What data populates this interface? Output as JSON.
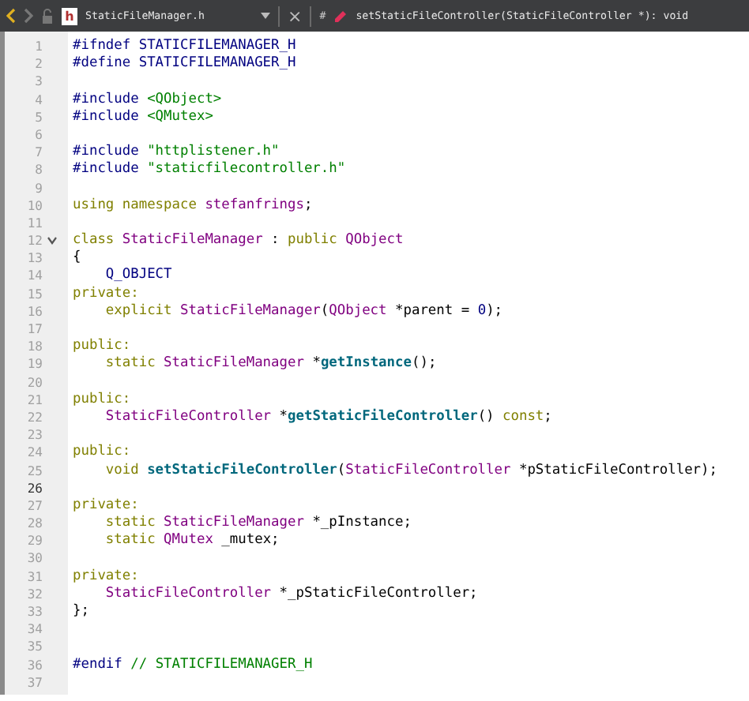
{
  "toolbar": {
    "back_enabled": true,
    "forward_enabled": false,
    "file_icon_label": "h",
    "file_name": "StaticFileManager.h",
    "close": "×",
    "hash": "#",
    "symbol": "setStaticFileController(StaticFileController *): void"
  },
  "lines": [
    {
      "number": "1",
      "selected": false,
      "foldable": false,
      "tokens": [
        {
          "kind": "pp",
          "text": "#ifndef STATICFILEMANAGER_H"
        }
      ]
    },
    {
      "number": "2",
      "selected": false,
      "foldable": false,
      "tokens": [
        {
          "kind": "pp",
          "text": "#define STATICFILEMANAGER_H"
        }
      ]
    },
    {
      "number": "3",
      "selected": false,
      "foldable": false
    },
    {
      "number": "4",
      "selected": false,
      "foldable": false,
      "tokens": [
        {
          "kind": "pp",
          "text": "#include "
        },
        {
          "kind": "str",
          "text": "<QObject>"
        }
      ]
    },
    {
      "number": "5",
      "selected": false,
      "foldable": false,
      "tokens": [
        {
          "kind": "pp",
          "text": "#include "
        },
        {
          "kind": "str",
          "text": "<QMutex>"
        }
      ]
    },
    {
      "number": "6",
      "selected": false,
      "foldable": false
    },
    {
      "number": "7",
      "selected": false,
      "foldable": false,
      "tokens": [
        {
          "kind": "pp",
          "text": "#include "
        },
        {
          "kind": "str",
          "text": "\"httplistener.h\""
        }
      ]
    },
    {
      "number": "8",
      "selected": false,
      "foldable": false,
      "tokens": [
        {
          "kind": "pp",
          "text": "#include "
        },
        {
          "kind": "str",
          "text": "\"staticfilecontroller.h\""
        }
      ]
    },
    {
      "number": "9",
      "selected": false,
      "foldable": false
    },
    {
      "number": "10",
      "selected": false,
      "foldable": false,
      "tokens": [
        {
          "kind": "kw",
          "text": "using namespace "
        },
        {
          "kind": "type",
          "text": "stefanfrings"
        },
        {
          "kind": "plain",
          "text": ";"
        }
      ]
    },
    {
      "number": "11",
      "selected": false,
      "foldable": false
    },
    {
      "number": "12",
      "selected": false,
      "foldable": true,
      "tokens": [
        {
          "kind": "kw",
          "text": "class "
        },
        {
          "kind": "type",
          "text": "StaticFileManager"
        },
        {
          "kind": "plain",
          "text": " : "
        },
        {
          "kind": "kw",
          "text": "public "
        },
        {
          "kind": "type",
          "text": "QObject"
        }
      ]
    },
    {
      "number": "13",
      "selected": false,
      "foldable": false,
      "tokens": [
        {
          "kind": "plain",
          "text": "{"
        }
      ]
    },
    {
      "number": "14",
      "selected": false,
      "foldable": false,
      "tokens": [
        {
          "kind": "pp",
          "text": "    Q_OBJECT"
        }
      ]
    },
    {
      "number": "15",
      "selected": false,
      "foldable": false,
      "tokens": [
        {
          "kind": "kw",
          "text": "private:"
        }
      ]
    },
    {
      "number": "16",
      "selected": false,
      "foldable": false,
      "tokens": [
        {
          "kind": "kw",
          "text": "    explicit "
        },
        {
          "kind": "type",
          "text": "StaticFileManager"
        },
        {
          "kind": "plain",
          "text": "("
        },
        {
          "kind": "type",
          "text": "QObject"
        },
        {
          "kind": "plain",
          "text": " *parent = "
        },
        {
          "kind": "num",
          "text": "0"
        },
        {
          "kind": "plain",
          "text": ");"
        }
      ]
    },
    {
      "number": "17",
      "selected": false,
      "foldable": false
    },
    {
      "number": "18",
      "selected": false,
      "foldable": false,
      "tokens": [
        {
          "kind": "kw",
          "text": "public:"
        }
      ]
    },
    {
      "number": "19",
      "selected": false,
      "foldable": false,
      "tokens": [
        {
          "kind": "kw",
          "text": "    static "
        },
        {
          "kind": "type",
          "text": "StaticFileManager"
        },
        {
          "kind": "plain",
          "text": " *"
        },
        {
          "kind": "fn",
          "text": "getInstance"
        },
        {
          "kind": "plain",
          "text": "();"
        }
      ]
    },
    {
      "number": "20",
      "selected": false,
      "foldable": false
    },
    {
      "number": "21",
      "selected": false,
      "foldable": false,
      "tokens": [
        {
          "kind": "kw",
          "text": "public:"
        }
      ]
    },
    {
      "number": "22",
      "selected": false,
      "foldable": false,
      "tokens": [
        {
          "kind": "type",
          "text": "    StaticFileController"
        },
        {
          "kind": "plain",
          "text": " *"
        },
        {
          "kind": "fn",
          "text": "getStaticFileController"
        },
        {
          "kind": "plain",
          "text": "() "
        },
        {
          "kind": "kw",
          "text": "const"
        },
        {
          "kind": "plain",
          "text": ";"
        }
      ]
    },
    {
      "number": "23",
      "selected": false,
      "foldable": false
    },
    {
      "number": "24",
      "selected": false,
      "foldable": false,
      "tokens": [
        {
          "kind": "kw",
          "text": "public:"
        }
      ]
    },
    {
      "number": "25",
      "selected": false,
      "foldable": false,
      "tokens": [
        {
          "kind": "kw",
          "text": "    void "
        },
        {
          "kind": "fn",
          "text": "setStaticFileController"
        },
        {
          "kind": "plain",
          "text": "("
        },
        {
          "kind": "type",
          "text": "StaticFileController"
        },
        {
          "kind": "plain",
          "text": " *pStaticFileController);"
        }
      ]
    },
    {
      "number": "26",
      "selected": true,
      "foldable": false
    },
    {
      "number": "27",
      "selected": false,
      "foldable": false,
      "tokens": [
        {
          "kind": "kw",
          "text": "private:"
        }
      ]
    },
    {
      "number": "28",
      "selected": false,
      "foldable": false,
      "tokens": [
        {
          "kind": "kw",
          "text": "    static "
        },
        {
          "kind": "type",
          "text": "StaticFileManager"
        },
        {
          "kind": "plain",
          "text": " *_pInstance;"
        }
      ]
    },
    {
      "number": "29",
      "selected": false,
      "foldable": false,
      "tokens": [
        {
          "kind": "kw",
          "text": "    static "
        },
        {
          "kind": "type",
          "text": "QMutex"
        },
        {
          "kind": "plain",
          "text": " _mutex;"
        }
      ]
    },
    {
      "number": "30",
      "selected": false,
      "foldable": false
    },
    {
      "number": "31",
      "selected": false,
      "foldable": false,
      "tokens": [
        {
          "kind": "kw",
          "text": "private:"
        }
      ]
    },
    {
      "number": "32",
      "selected": false,
      "foldable": false,
      "tokens": [
        {
          "kind": "type",
          "text": "    StaticFileController"
        },
        {
          "kind": "plain",
          "text": " *_pStaticFileController;"
        }
      ]
    },
    {
      "number": "33",
      "selected": false,
      "foldable": false,
      "tokens": [
        {
          "kind": "plain",
          "text": "};"
        }
      ]
    },
    {
      "number": "34",
      "selected": false,
      "foldable": false
    },
    {
      "number": "35",
      "selected": false,
      "foldable": false
    },
    {
      "number": "36",
      "selected": false,
      "foldable": false,
      "tokens": [
        {
          "kind": "pp",
          "text": "#endif "
        },
        {
          "kind": "comment",
          "text": "// STATICFILEMANAGER_H"
        }
      ]
    },
    {
      "number": "37",
      "selected": false,
      "foldable": false
    }
  ]
}
